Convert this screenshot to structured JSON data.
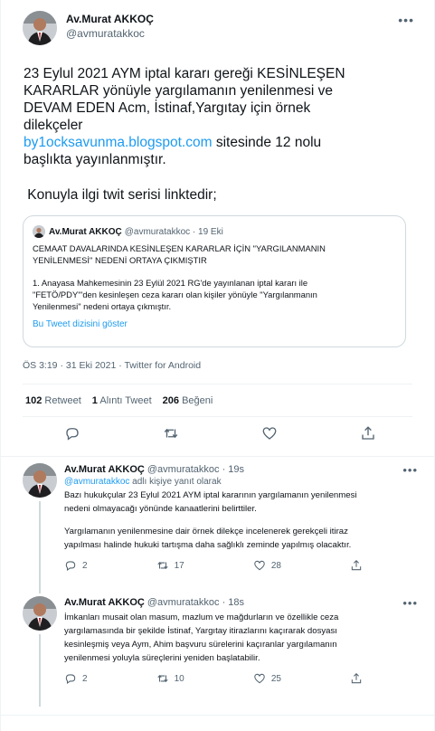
{
  "main": {
    "display_name": "Av.Murat AKKOÇ",
    "handle": "@avmuratakkoc",
    "text_lines": [
      "23 Eylul 2021 AYM iptal kararı gereği KESİNLEŞEN",
      "KARARLAR yönüyle yargılamanın yenilenmesi ve",
      "DEVAM EDEN Acm, İstinaf,Yargıtay için örnek",
      "dilekçeler"
    ],
    "link_text": "by1ocksavunma.blogspot.com",
    "after_link": " sitesinde 12 nolu",
    "line6": "başlıkta yayınlanmıştır.",
    "line7": " Konuyla ilgi twit serisi linktedir;",
    "timestamp": "ÖS 3:19 · 31 Eki 2021 · Twitter for Android",
    "stats": {
      "retweets": "102",
      "retweets_label": "Retweet",
      "quotes": "1",
      "quotes_label": "Alıntı Tweet",
      "likes": "206",
      "likes_label": "Beğeni"
    }
  },
  "quote": {
    "display_name": "Av.Murat AKKOÇ",
    "meta": "@avmuratakkoc · 19 Eki",
    "line1": "CEMAAT DAVALARINDA KESİNLEŞEN KARARLAR İÇİN \"YARGILANMANIN",
    "line2": "YENİLENMESİ\" NEDENİ ORTAYA ÇIKMIŞTIR",
    "line3": "1. Anayasa Mahkemesinin 23 Eylül 2021 RG'de yayınlanan iptal kararı ile",
    "line4": "\"FETÖ/PDY\"'den kesinleşen ceza kararı olan kişiler yönüyle \"Yargılanmanın",
    "line5": "Yenilenmesi\" nedeni ortaya çıkmıştır.",
    "show_thread": "Bu Tweet dizisini göster"
  },
  "replies": [
    {
      "name": "Av.Murat AKKOÇ",
      "meta": "@avmuratakkoc · 19s",
      "reply_to_handle": "@avmuratakkoc",
      "reply_to_suffix": " adlı kişiye yanıt olarak",
      "p1_l1": "Bazı hukukçular 23 Eylul 2021 AYM iptal kararının yargılamanın yenilenmesi",
      "p1_l2": "nedeni olmayacağı  yönünde kanaatlerini belirttiler.",
      "p2_l1": "Yargılamanın yenilenmesine dair örnek dilekçe incelenerek gerekçeli itiraz",
      "p2_l2": "yapılması halinde hukuki tartışma daha sağlıklı  zeminde yapılmış olacaktır.",
      "replies": "2",
      "retweets": "17",
      "likes": "28"
    },
    {
      "name": "Av.Murat AKKOÇ",
      "meta": "@avmuratakkoc · 18s",
      "l1": "İmkanları musait olan masum, mazlum ve mağdurların ve özellikle ceza",
      "l2": "yargılamasında bir şekilde İstinaf, Yargıtay itirazlarını kaçırarak dosyası",
      "l3": "kesinleşmiş veya Aym, Ahim başvuru sürelerini kaçıranlar yargılamanın",
      "l4": "yenilenmesi yoluyla süreçlerini yeniden başlatabilir.",
      "replies": "2",
      "retweets": "10",
      "likes": "25"
    }
  ],
  "icons": {
    "more": "more-dots-icon",
    "reply": "reply-icon",
    "retweet": "retweet-icon",
    "like": "heart-icon",
    "share": "share-icon"
  },
  "colors": {
    "link": "#1d9bf0",
    "secondary_text": "#536471",
    "border": "#cfd9de"
  }
}
